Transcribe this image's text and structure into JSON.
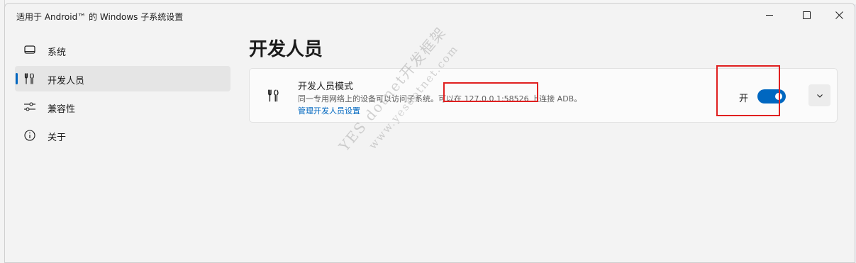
{
  "window": {
    "title": "适用于 Android™ 的 Windows 子系统设置"
  },
  "sidebar": {
    "items": [
      {
        "label": "系统",
        "icon": "laptop-icon",
        "selected": false
      },
      {
        "label": "开发人员",
        "icon": "tools-icon",
        "selected": true
      },
      {
        "label": "兼容性",
        "icon": "sliders-icon",
        "selected": false
      },
      {
        "label": "关于",
        "icon": "info-icon",
        "selected": false
      }
    ]
  },
  "main": {
    "page_title": "开发人员",
    "developer_mode": {
      "title": "开发人员模式",
      "description": "同一专用网络上的设备可以访问子系统。可以在 127.0.0.1:58526 上连接 ADB。",
      "link": "管理开发人员设置",
      "toggle_label": "开",
      "toggle_on": true
    }
  },
  "watermark": {
    "line1": "YES dotnet开发框架",
    "line2": "www.yesdotnet.com"
  },
  "colors": {
    "accent": "#0067c0",
    "annotation": "#e02020",
    "window_bg": "#f3f3f3"
  }
}
